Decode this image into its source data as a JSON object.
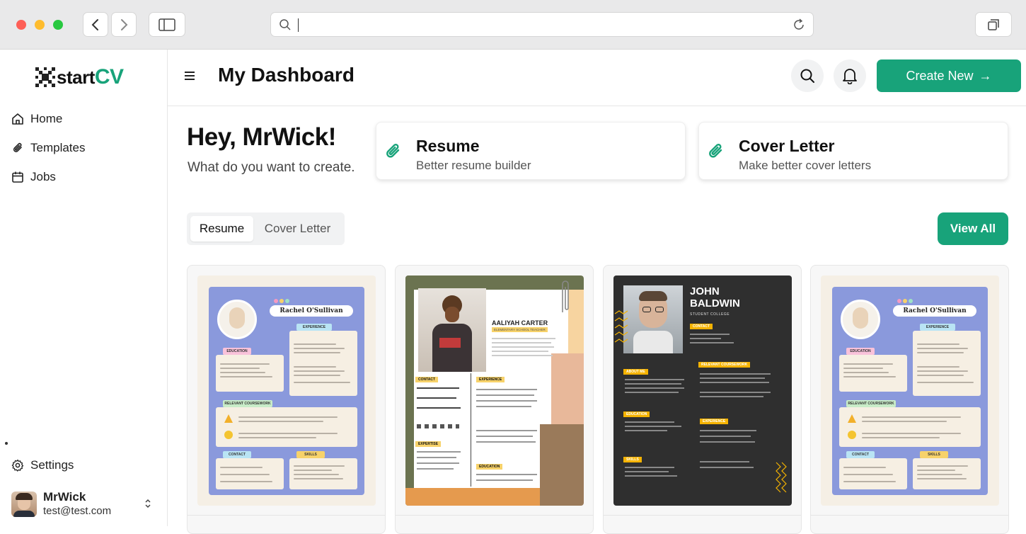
{
  "browser": {
    "url": "",
    "search_icon": "search-icon",
    "reload_icon": "reload-icon"
  },
  "sidebar": {
    "logo": {
      "prefix": "start",
      "suffix": "CV"
    },
    "items": [
      {
        "label": "Home",
        "icon": "home-icon"
      },
      {
        "label": "Templates",
        "icon": "paperclip-icon"
      },
      {
        "label": "Jobs",
        "icon": "calendar-icon"
      }
    ],
    "settings": {
      "label": "Settings",
      "icon": "gear-icon"
    },
    "user": {
      "name": "MrWick",
      "email": "test@test.com"
    }
  },
  "header": {
    "title": "My Dashboard",
    "create_label": "Create New",
    "create_arrow": "→"
  },
  "main": {
    "greeting": "Hey, MrWick!",
    "subtitle": "What do you want to create.",
    "cards": [
      {
        "title": "Resume",
        "subtitle": "Better resume builder"
      },
      {
        "title": "Cover Letter",
        "subtitle": "Make better cover letters"
      }
    ],
    "tabs": [
      {
        "label": "Resume",
        "active": true
      },
      {
        "label": "Cover Letter",
        "active": false
      }
    ],
    "view_all": "View All",
    "templates": [
      {
        "name": "Rachel O'Sullivan",
        "sections": [
          "EXPERIENCE",
          "EDUCATION",
          "RELEVANT COURSEWORK",
          "CONTACT",
          "SKILLS"
        ]
      },
      {
        "name": "AALIYAH CARTER",
        "role": "ELEMENTARY SCHOOL TEACHER",
        "sections": [
          "CONTACT",
          "EXPERIENCE",
          "EXPERTISE",
          "EDUCATION"
        ]
      },
      {
        "name_first": "JOHN",
        "name_last": "BALDWIN",
        "role": "STUDENT COLLEGE",
        "sections": [
          "CONTACT",
          "RELEVANT COURSEWORK",
          "ABOUT ME",
          "EDUCATION",
          "EXPERIENCE",
          "SKILLS"
        ]
      },
      {
        "name": "Rachel O'Sullivan",
        "sections": [
          "EXPERIENCE",
          "EDUCATION",
          "RELEVANT COURSEWORK",
          "CONTACT",
          "SKILLS"
        ]
      }
    ]
  },
  "colors": {
    "brand": "#18a37a",
    "rachel_panel": "#8a99dc",
    "john_bg": "#2f2f2f",
    "john_accent": "#f5b301"
  }
}
